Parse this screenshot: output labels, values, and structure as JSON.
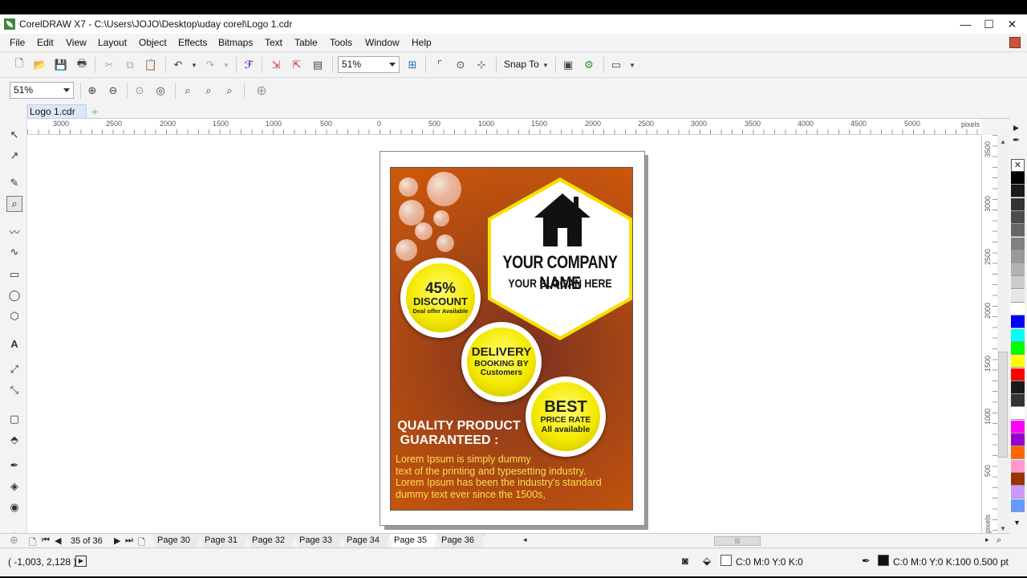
{
  "window": {
    "title": "CorelDRAW X7 - C:\\Users\\JOJO\\Desktop\\uday corel\\Logo 1.cdr",
    "minimize": "—",
    "maximize": "☐",
    "close": "✕"
  },
  "menu": {
    "items": [
      "File",
      "Edit",
      "View",
      "Layout",
      "Object",
      "Effects",
      "Bitmaps",
      "Text",
      "Table",
      "Tools",
      "Window",
      "Help"
    ]
  },
  "toolbar": {
    "zoom_value": "51%",
    "snap_to": "Snap To",
    "zoom2_value": "51%"
  },
  "document": {
    "tab_label": "Logo 1.cdr",
    "add_tab": "+"
  },
  "ruler": {
    "h_labels": [
      "3000",
      "2500",
      "2000",
      "1500",
      "1000",
      "500",
      "0",
      "500",
      "1000",
      "1500",
      "2000",
      "2500",
      "3000",
      "3500",
      "4000",
      "4500",
      "5000"
    ],
    "h_unit": "pixels",
    "v_labels": [
      "3500",
      "3000",
      "2500",
      "2000",
      "1500",
      "1000",
      "500"
    ],
    "v_unit": "pixels"
  },
  "flyer": {
    "company_name": "YOUR COMPANY NAME",
    "slogan": "YOUR SLOGAN HERE",
    "badge1_big": "45%",
    "badge1_mid": "DISCOUNT",
    "badge1_small": "Deal offer Available",
    "badge2_big": "DELIVERY",
    "badge2_mid": "BOOKING BY",
    "badge2_small": "Customers",
    "badge3_big": "BEST",
    "badge3_mid": "PRICE RATE",
    "badge3_small": "All available",
    "quality_line1": "QUALITY PRODUCT",
    "quality_line2": "GUARANTEED :",
    "lorem_line1": "Lorem Ipsum is simply dummy",
    "lorem_line2": "text of the printing and typesetting industry.",
    "lorem_line3": "Lorem Ipsum has been the industry's standard",
    "lorem_line4": "dummy text ever since the 1500s,"
  },
  "pages": {
    "count_label": "35 of 36",
    "tabs": [
      "Page 30",
      "Page 31",
      "Page 32",
      "Page 33",
      "Page 34",
      "Page 35",
      "Page 36"
    ],
    "active": "Page 35"
  },
  "status": {
    "coords": "( -1,003, 2,128  )",
    "fill": "C:0 M:0 Y:0 K:0",
    "outline": "C:0 M:0 Y:0 K:100  0.500 pt"
  },
  "palette": [
    "#ffffff",
    "#000000",
    "#1a1a1a",
    "#333333",
    "#4d4d4d",
    "#666666",
    "#808080",
    "#999999",
    "#b3b3b3",
    "#cccccc",
    "#e6e6e6",
    "#ffffff",
    "#0000ff",
    "#00ffff",
    "#00ff00",
    "#ffff00",
    "#ff0000",
    "#1a1a1a",
    "#333333",
    "#ffffff",
    "#ff00ff",
    "#9900cc",
    "#ff6600",
    "#ff99cc",
    "#993300",
    "#cc99ff",
    "#6699ff"
  ],
  "colors": {
    "flyer_orange": "#d05a0a",
    "badge_yellow": "#f4ea00",
    "lorem_yellow": "#f7e04a"
  }
}
